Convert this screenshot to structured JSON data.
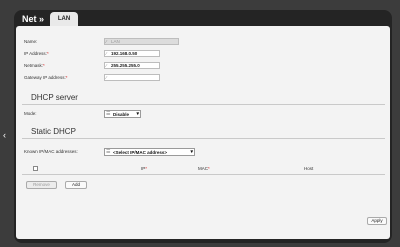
{
  "header": {
    "breadcrumb": "Net »",
    "tab": "LAN"
  },
  "form": {
    "name": {
      "label": "Name:",
      "value": "LAN"
    },
    "ip": {
      "label": "IP Address:",
      "value": "192.168.0.50"
    },
    "netmask": {
      "label": "Netmask:",
      "value": "255.255.255.0"
    },
    "gateway": {
      "label": "Gateway IP address:",
      "value": ""
    }
  },
  "dhcp_server": {
    "title": "DHCP server",
    "mode_label": "Mode:",
    "mode_value": "Disable"
  },
  "static_dhcp": {
    "title": "Static DHCP",
    "known_label": "Known IP/MAC addresses:",
    "known_value": "<Select IP/MAC address>",
    "columns": {
      "ip": "IP",
      "mac": "MAC",
      "host": "Host"
    },
    "remove_label": "Remove",
    "add_label": "Add"
  },
  "apply_label": "Apply",
  "icons": {
    "nav": "chevron-left-icon",
    "edit": "pencil-icon",
    "select": "list-icon"
  }
}
